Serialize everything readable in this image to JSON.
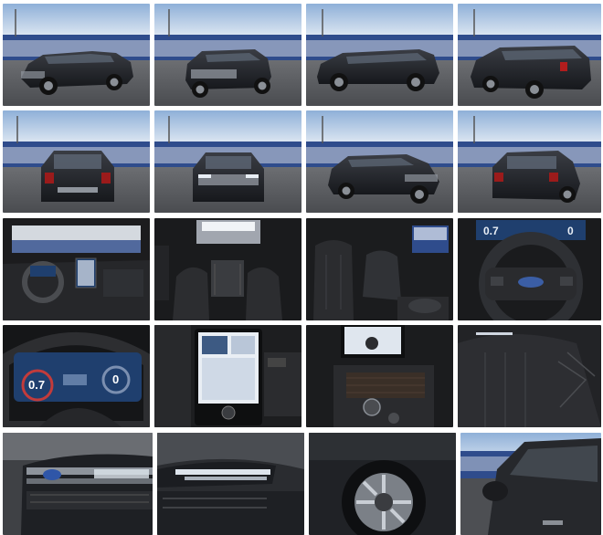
{
  "gallery": {
    "colors": {
      "sky_top": "#9db7d6",
      "sky_bottom": "#dfe7f0",
      "wall": "#2f4c8c",
      "pavement": "#5c5e61",
      "vehicle": "#202226",
      "interior": "#1c1c1e",
      "screen": "#1f3f6e"
    },
    "cluster": {
      "speed_left": "0.7",
      "speed_right": "0"
    },
    "tiles": [
      {
        "view": "exterior-front-three-quarter-left"
      },
      {
        "view": "exterior-front-three-quarter-right"
      },
      {
        "view": "exterior-side-profile"
      },
      {
        "view": "exterior-rear-three-quarter"
      },
      {
        "view": "exterior-rear"
      },
      {
        "view": "exterior-front"
      },
      {
        "view": "exterior-front-three-quarter-high"
      },
      {
        "view": "exterior-rear-three-quarter-right"
      },
      {
        "view": "interior-dashboard"
      },
      {
        "view": "interior-front-seats-panoramic-roof"
      },
      {
        "view": "interior-rear-seats"
      },
      {
        "view": "interior-steering-wheel-cluster"
      },
      {
        "view": "interior-digital-cluster"
      },
      {
        "view": "interior-center-touchscreen"
      },
      {
        "view": "interior-center-console"
      },
      {
        "view": "interior-seat-stitching-detail"
      },
      {
        "view": "detail-front-grille"
      },
      {
        "view": "detail-headlamp"
      },
      {
        "view": "detail-wheel"
      },
      {
        "view": "detail-side-mirror"
      }
    ]
  }
}
